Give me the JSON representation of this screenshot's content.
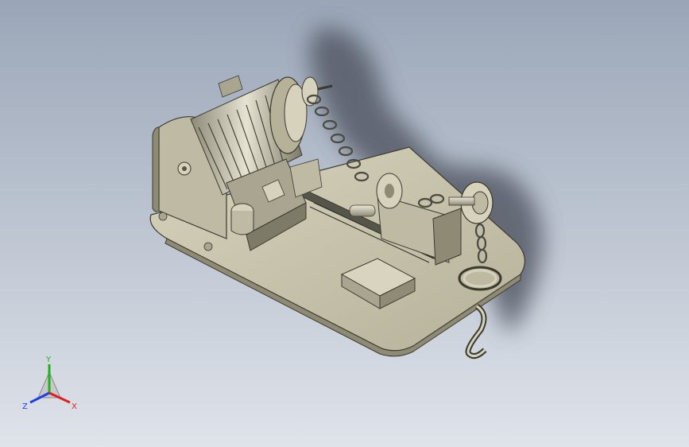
{
  "viewport": {
    "background_top": "#9aa6b8",
    "background_bottom": "#dfe3ea"
  },
  "triad": {
    "x_label": "X",
    "y_label": "Y",
    "z_label": "Z",
    "x_color": "#e02020",
    "y_color": "#20b020",
    "z_color": "#2040e0"
  },
  "model": {
    "body_color": "#c8c4ac",
    "edge_color": "#3a3a30",
    "shadow_color": "#5a5f6b"
  }
}
